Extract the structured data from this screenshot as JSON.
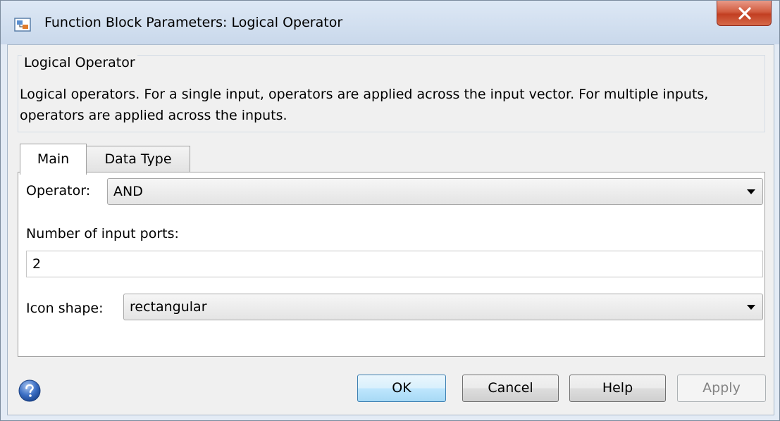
{
  "window": {
    "title": "Function Block Parameters: Logical Operator"
  },
  "description": {
    "group_title": "Logical Operator",
    "text": "Logical operators.  For a single input, operators are applied across the input vector.  For multiple inputs, operators are applied across the inputs."
  },
  "tabs": [
    {
      "label": "Main",
      "active": true
    },
    {
      "label": "Data Type",
      "active": false
    }
  ],
  "main": {
    "operator_label": "Operator:",
    "operator_value": "AND",
    "num_inputs_label": "Number of input ports:",
    "num_inputs_value": "2",
    "icon_shape_label": "Icon shape:",
    "icon_shape_value": "rectangular"
  },
  "buttons": {
    "ok": "OK",
    "cancel": "Cancel",
    "help": "Help",
    "apply": "Apply"
  },
  "icons": {
    "app": "simulink-block-icon",
    "close": "close-icon",
    "help": "question-mark-icon"
  },
  "colors": {
    "close_button": "#c8452a",
    "ok_button_border": "#3c7fb1",
    "dialog_background": "#f0f0f0"
  }
}
